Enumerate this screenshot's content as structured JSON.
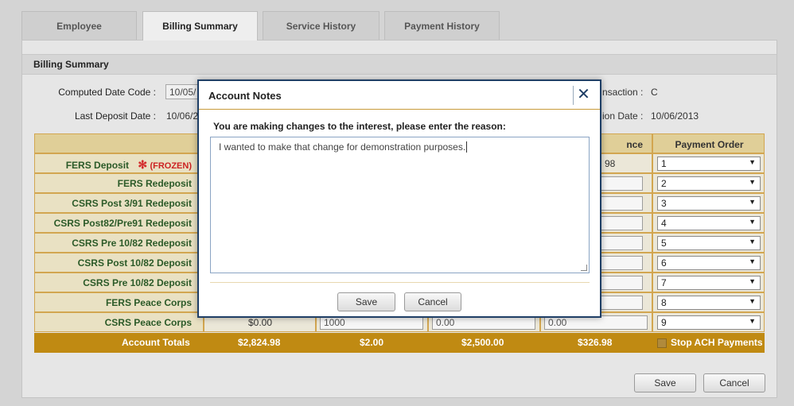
{
  "tabs": [
    "Employee",
    "Billing Summary",
    "Service History",
    "Payment History"
  ],
  "section_title": "Billing Summary",
  "fields": {
    "computed_date_code_label": "Computed Date Code :",
    "computed_date_code_value": "10/05/",
    "last_deposit_date_label": "Last Deposit Date :",
    "last_deposit_date_value": "10/06/2",
    "transaction_label": "nsaction :",
    "transaction_value": "C",
    "date_label": "ion Date :",
    "date_value": "10/06/2013"
  },
  "table": {
    "headers": {
      "balance_partial": "nce",
      "payment_order": "Payment Order"
    },
    "rows": [
      {
        "name": "FERS Deposit",
        "frozen": "(FROZEN)",
        "balance": "98",
        "order": "1"
      },
      {
        "name": "FERS Redeposit",
        "order": "2"
      },
      {
        "name": "CSRS Post 3/91 Redeposit",
        "order": "3"
      },
      {
        "name": "CSRS Post82/Pre91 Redeposit",
        "order": "4"
      },
      {
        "name": "CSRS Pre 10/82 Redeposit",
        "order": "5"
      },
      {
        "name": "CSRS Post 10/82 Deposit",
        "order": "6"
      },
      {
        "name": "CSRS Pre 10/82 Deposit",
        "order": "7"
      },
      {
        "name": "FERS Peace Corps",
        "order": "8"
      },
      {
        "name": "CSRS Peace Corps",
        "col1": "$0.00",
        "col2": "1000",
        "col3": "0.00",
        "col4": "0.00",
        "order": "9"
      }
    ],
    "totals": {
      "label": "Account Totals",
      "c1": "$2,824.98",
      "c2": "$2.00",
      "c3": "$2,500.00",
      "c4": "$326.98",
      "stop_ach": "Stop ACH Payments"
    }
  },
  "buttons": {
    "save": "Save",
    "cancel": "Cancel"
  },
  "modal": {
    "title": "Account Notes",
    "close": "✕",
    "prompt": "You are making changes to the interest, please enter the reason:",
    "note": "I wanted to make that change for demonstration purposes.",
    "save": "Save",
    "cancel": "Cancel"
  },
  "colors": {
    "accent": "#c08a12",
    "row_border": "#d2a650",
    "label_green": "#2b5a28",
    "modal_border": "#1f3f66"
  }
}
